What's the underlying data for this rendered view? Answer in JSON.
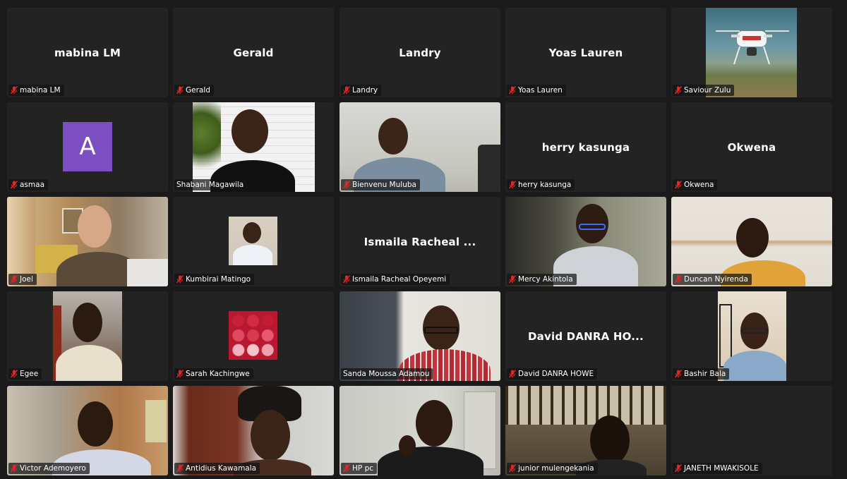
{
  "window": {
    "background": "#1a1a1a",
    "active_speaker_color": "#23d959",
    "muted_icon_color": "#e02828"
  },
  "participants": [
    {
      "name": "mabina LM",
      "display": "mabina LM",
      "muted": true,
      "video": false
    },
    {
      "name": "Gerald",
      "display": "Gerald",
      "muted": true,
      "video": false
    },
    {
      "name": "Landry",
      "display": "Landry",
      "muted": true,
      "video": false
    },
    {
      "name": "Yoas Lauren",
      "display": "Yoas Lauren",
      "muted": true,
      "video": false
    },
    {
      "name": "Saviour Zulu",
      "muted": true,
      "video": true
    },
    {
      "name": "asmaa",
      "avatar_letter": "A",
      "muted": true,
      "video": false
    },
    {
      "name": "Shabani Magawila",
      "muted": false,
      "video": true
    },
    {
      "name": "Bienvenu Muluba",
      "muted": true,
      "video": true
    },
    {
      "name": "herry kasunga",
      "display": "herry kasunga",
      "muted": true,
      "video": false
    },
    {
      "name": "Okwena",
      "display": "Okwena",
      "muted": true,
      "video": false
    },
    {
      "name": "Joel",
      "muted": true,
      "video": true
    },
    {
      "name": "Kumbirai Matingo",
      "muted": true,
      "video": true
    },
    {
      "name": "Ismaila Racheal Opeyemi",
      "display": "Ismaila Racheal ...",
      "muted": true,
      "video": false
    },
    {
      "name": "Mercy Akintola",
      "muted": true,
      "video": true
    },
    {
      "name": "Duncan Nyirenda",
      "muted": true,
      "video": true
    },
    {
      "name": "Egee",
      "muted": true,
      "video": true
    },
    {
      "name": "Sarah Kachingwe",
      "muted": true,
      "video": true
    },
    {
      "name": "Sanda Moussa Adamou",
      "muted": false,
      "video": true
    },
    {
      "name": "David DANRA HOWE",
      "display": "David DANRA HO...",
      "muted": true,
      "video": false
    },
    {
      "name": "Bashir Bala",
      "muted": true,
      "video": true
    },
    {
      "name": "Victor Ademoyero",
      "muted": true,
      "video": true
    },
    {
      "name": "Antidius Kawamala",
      "muted": true,
      "video": true
    },
    {
      "name": "HP pc",
      "muted": true,
      "video": true,
      "active_speaker": true
    },
    {
      "name": "junior mulengekania",
      "muted": true,
      "video": true
    },
    {
      "name": "JANETH MWAKISOLE",
      "muted": true,
      "video": false
    }
  ]
}
